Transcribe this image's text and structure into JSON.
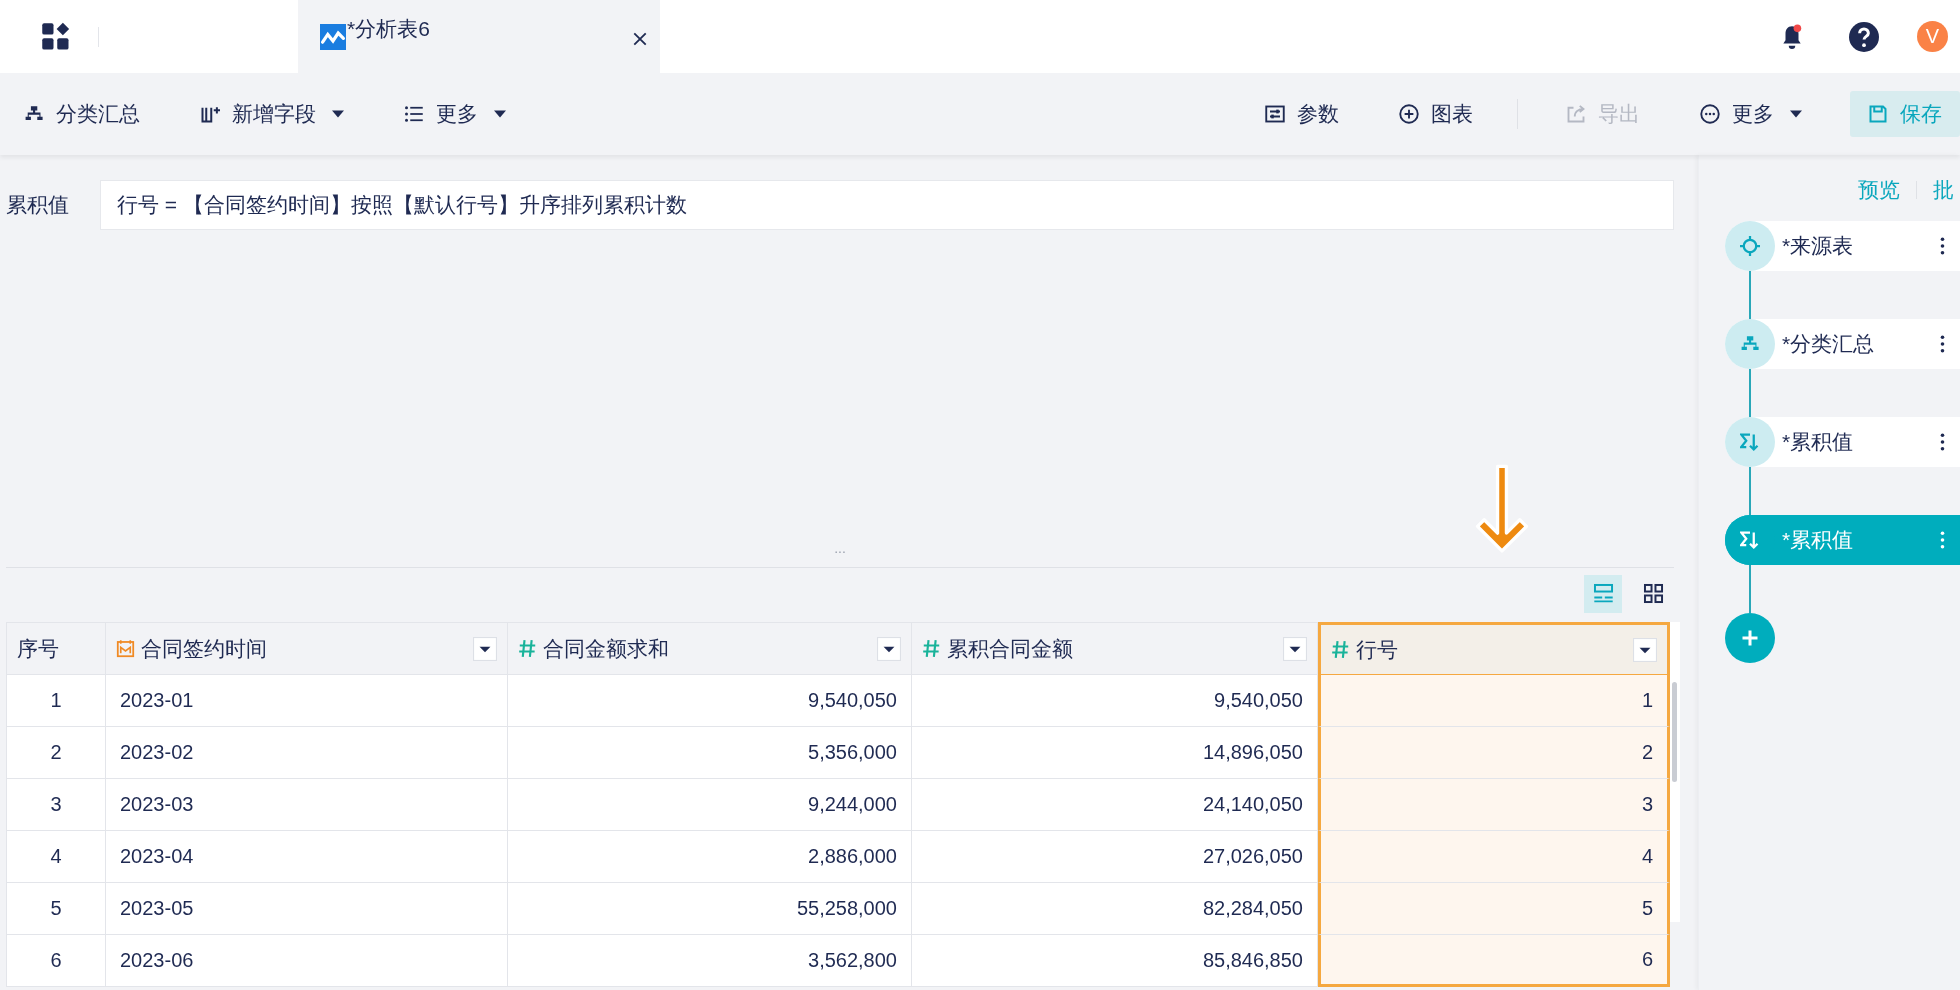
{
  "app_bar": {
    "tab": {
      "title": "*分析表6"
    },
    "notifications": {
      "unread": true
    },
    "avatar": {
      "initial": "V"
    }
  },
  "toolbar": {
    "left": [
      {
        "label": "分类汇总",
        "kind": "summary",
        "dropdown": false
      },
      {
        "label": "新增字段",
        "kind": "add-field",
        "dropdown": true
      },
      {
        "label": "更多",
        "kind": "list",
        "dropdown": true
      }
    ],
    "right": [
      {
        "label": "参数",
        "kind": "params",
        "disabled": false,
        "dropdown": false
      },
      {
        "label": "图表",
        "kind": "chart",
        "disabled": false,
        "dropdown": false
      },
      {
        "label": "导出",
        "kind": "export",
        "disabled": true,
        "dropdown": false
      },
      {
        "label": "更多",
        "kind": "more",
        "disabled": false,
        "dropdown": true
      },
      {
        "label": "保存",
        "kind": "save",
        "disabled": false,
        "dropdown": false
      }
    ]
  },
  "formula": {
    "label": "累积值",
    "value": "行号 = 【合同签约时间】按照【默认行号】升序排列累积计数"
  },
  "splitter": {
    "label": "..."
  },
  "view_toggle": [
    {
      "kind": "rows",
      "selected": true
    },
    {
      "kind": "grid",
      "selected": false
    }
  ],
  "table": {
    "columns": [
      {
        "label": "序号",
        "kind": "index",
        "selected": false
      },
      {
        "label": "合同签约时间",
        "kind": "date",
        "selected": false
      },
      {
        "label": "合同金额求和",
        "kind": "number",
        "selected": false
      },
      {
        "label": "累积合同金额",
        "kind": "number",
        "selected": false
      },
      {
        "label": "行号",
        "kind": "number",
        "selected": true
      }
    ],
    "rows": [
      [
        "1",
        "2023-01",
        "9,540,050",
        "9,540,050",
        "1"
      ],
      [
        "2",
        "2023-02",
        "5,356,000",
        "14,896,050",
        "2"
      ],
      [
        "3",
        "2023-03",
        "9,244,000",
        "24,140,050",
        "3"
      ],
      [
        "4",
        "2023-04",
        "2,886,000",
        "27,026,050",
        "4"
      ],
      [
        "5",
        "2023-05",
        "55,258,000",
        "82,284,050",
        "5"
      ],
      [
        "6",
        "2023-06",
        "3,562,800",
        "85,846,850",
        "6"
      ]
    ]
  },
  "flow": {
    "links": [
      {
        "label": "预览"
      },
      {
        "label": "批"
      }
    ],
    "nodes": [
      {
        "label": "*来源表",
        "kind": "source",
        "selected": false
      },
      {
        "label": "*分类汇总",
        "kind": "summary",
        "selected": false
      },
      {
        "label": "*累积值",
        "kind": "cumulative",
        "selected": false
      },
      {
        "label": "*累积值",
        "kind": "cumulative",
        "selected": true
      }
    ]
  }
}
